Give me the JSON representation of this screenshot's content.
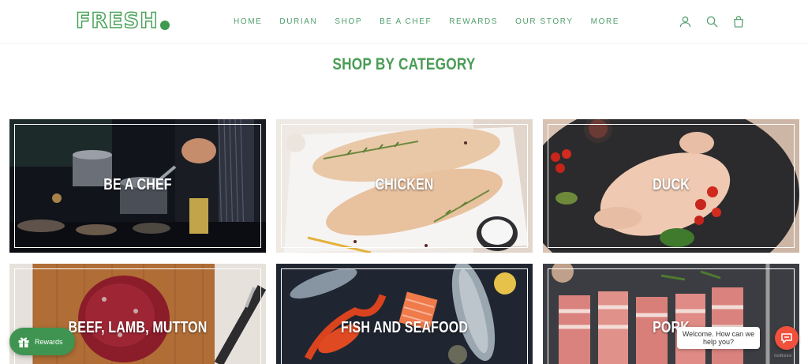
{
  "brand": {
    "logo_text": "FRESH",
    "accent": "#49a35a",
    "nav_color": "#4e9d6a"
  },
  "nav": {
    "items": [
      {
        "label": "HOME"
      },
      {
        "label": "DURIAN"
      },
      {
        "label": "SHOP"
      },
      {
        "label": "BE A CHEF"
      },
      {
        "label": "REWARDS"
      },
      {
        "label": "OUR STORY"
      },
      {
        "label": "MORE"
      }
    ]
  },
  "header_icons": [
    "account-icon",
    "search-icon",
    "cart-icon"
  ],
  "section": {
    "title": "SHOP BY CATEGORY"
  },
  "categories": [
    {
      "label": "BE A CHEF"
    },
    {
      "label": "CHICKEN"
    },
    {
      "label": "DUCK"
    },
    {
      "label": "BEEF, LAMB, MUTTON"
    },
    {
      "label": "FISH AND SEAFOOD"
    },
    {
      "label": "PORK"
    }
  ],
  "rewards": {
    "label": "Rewards",
    "color": "#3e9450"
  },
  "chat": {
    "bubble_line1": "Welcome. How can we",
    "bubble_line2": "help you?",
    "button_color": "#f1503d",
    "powered": "GetButton"
  }
}
